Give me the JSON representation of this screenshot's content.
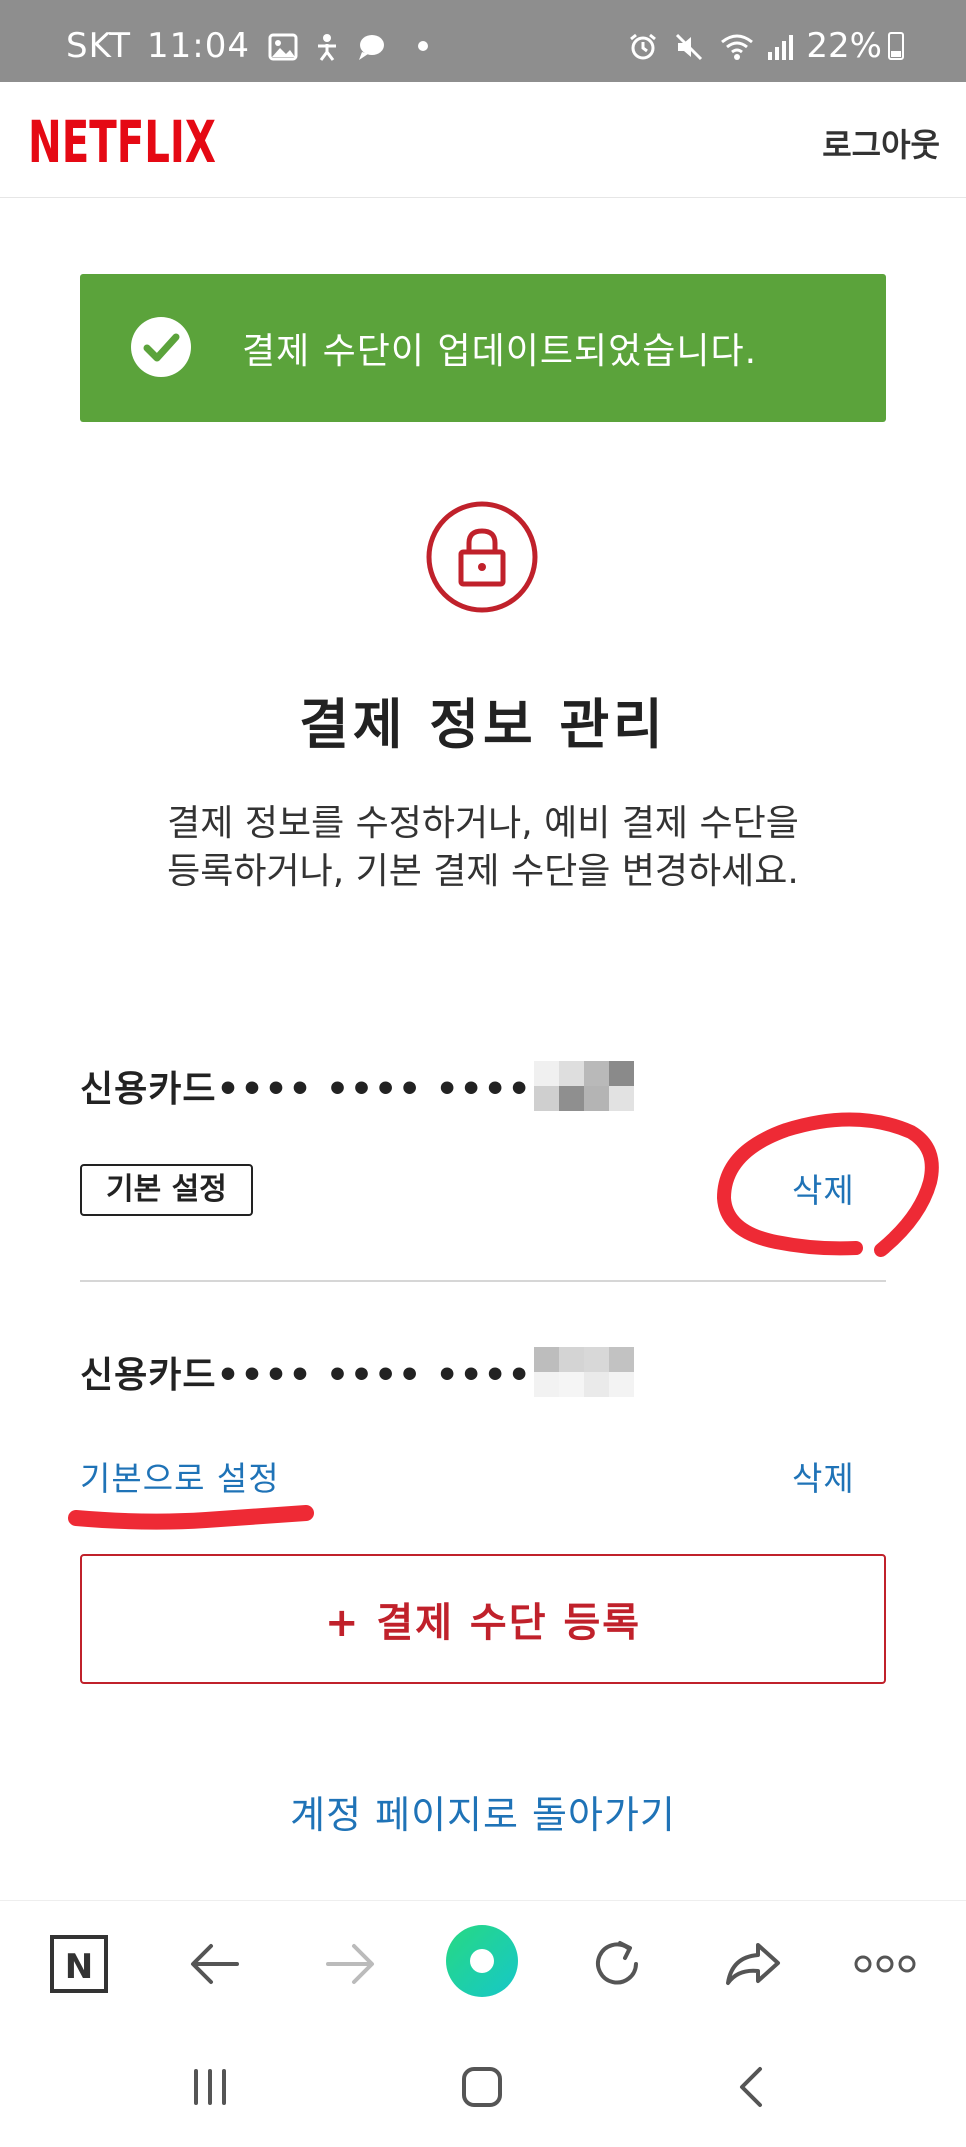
{
  "status_bar": {
    "carrier": "SKT",
    "time": "11:04",
    "battery": "22%",
    "left_icons": [
      "gallery-icon",
      "accessibility-icon",
      "chat-bubble-icon",
      "notification-dot-icon"
    ],
    "right_icons": [
      "alarm-icon",
      "mute-vibrate-icon",
      "wifi-icon",
      "signal-icon",
      "battery-icon"
    ]
  },
  "header": {
    "logo_text": "NETFLIX",
    "logout_label": "로그아웃"
  },
  "banner": {
    "message": "결제 수단이 업데이트되었습니다.",
    "icon": "check-circle-icon",
    "color": "#5ba33b"
  },
  "main": {
    "icon": "lock-icon",
    "title": "결제 정보 관리",
    "description_line1": "결제 정보를 수정하거나, 예비 결제 수단을",
    "description_line2": "등록하거나, 기본 결제 수단을 변경하세요."
  },
  "payment_methods": [
    {
      "label": "신용카드•••• •••• ••••",
      "status_badge": "기본 설정",
      "delete_label": "삭제"
    },
    {
      "label": "신용카드•••• •••• ••••",
      "set_default_label": "기본으로 설정",
      "delete_label": "삭제"
    }
  ],
  "add_button_label": "+ 결제 수단 등록",
  "back_link_label": "계정 페이지로 돌아가기",
  "colors": {
    "accent_red": "#c0212b",
    "link_blue": "#1f73b7",
    "success_green": "#5ba33b",
    "annotation_red": "#ee2a35"
  },
  "browser_toolbar": {
    "buttons": [
      "naver-home-icon",
      "back-arrow-icon",
      "forward-arrow-icon",
      "green-dot-icon",
      "refresh-icon",
      "share-icon",
      "more-icon"
    ]
  },
  "system_nav": {
    "buttons": [
      "recent-apps-icon",
      "home-icon",
      "back-icon"
    ]
  }
}
